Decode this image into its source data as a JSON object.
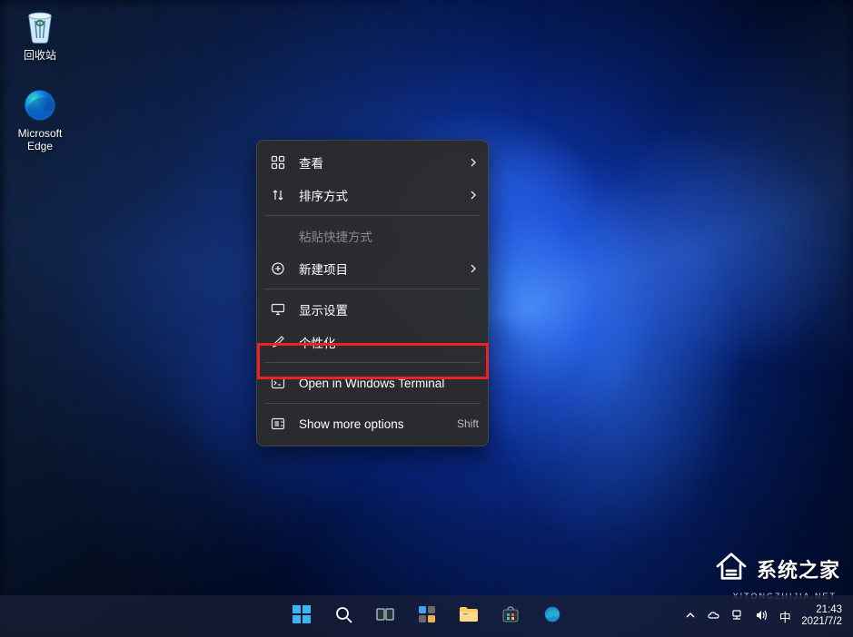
{
  "desktop_icons": {
    "recycle_bin": {
      "label": "回收站"
    },
    "edge": {
      "label": "Microsoft Edge"
    }
  },
  "context_menu": {
    "view": {
      "label": "查看"
    },
    "sort": {
      "label": "排序方式"
    },
    "paste_shortcut": {
      "label": "粘贴快捷方式"
    },
    "new": {
      "label": "新建项目"
    },
    "display_settings": {
      "label": "显示设置"
    },
    "personalize": {
      "label": "个性化"
    },
    "open_terminal": {
      "label": "Open in Windows Terminal"
    },
    "show_more": {
      "label": "Show more options",
      "shortcut": "Shift"
    }
  },
  "taskbar": {
    "time": "21:43",
    "date": "2021/7/2"
  },
  "watermark": {
    "title": "系统之家",
    "subtitle": "XITONGZHIJIA.NET"
  },
  "colors": {
    "highlight": "#e22222",
    "menu_bg": "#2c2c2c"
  }
}
